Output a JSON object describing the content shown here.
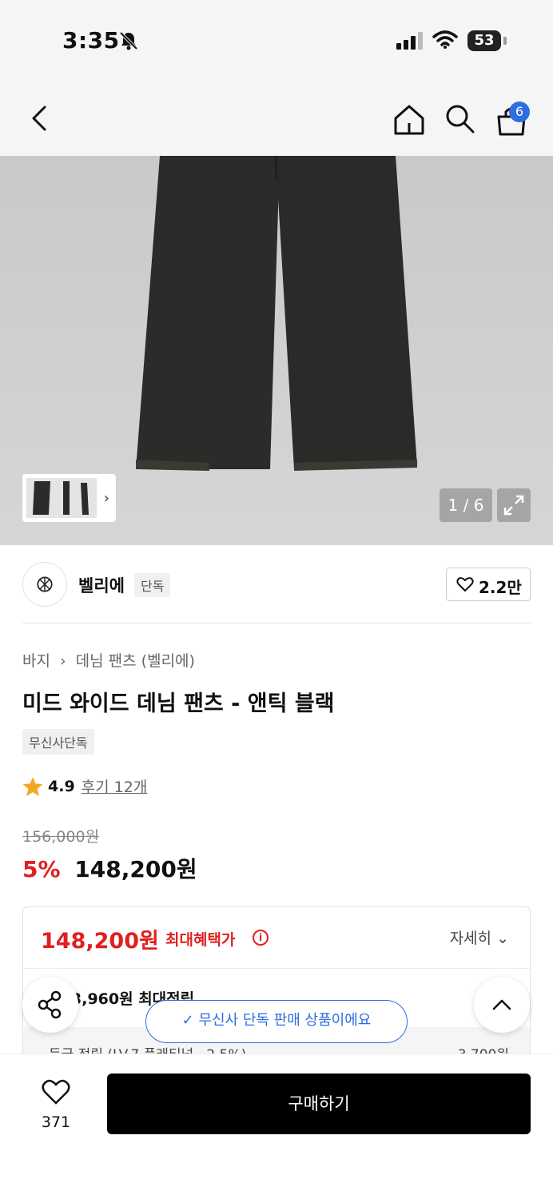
{
  "status": {
    "time": "3:35",
    "battery": "53"
  },
  "header": {
    "cart_count": "6"
  },
  "gallery": {
    "counter": "1 / 6"
  },
  "brand": {
    "name": "벨리에",
    "tag": "단독",
    "likes": "2.2만"
  },
  "breadcrumb": {
    "category": "바지",
    "sub": "데님 팬츠 (벨리에)"
  },
  "product": {
    "title": "미드 와이드 데님 팬츠 - 앤틱 블랙",
    "exclusive_tag": "무신사단독",
    "rating": "4.9",
    "reviews": "후기 12개",
    "original_price": "156,000원",
    "discount": "5%",
    "price": "148,200원"
  },
  "benefit": {
    "price": "148,200원",
    "label": "최대혜택가",
    "detail": "자세히",
    "point_line": "3,960원 최대적립",
    "grade_label": "등급 적립 (LV.7 플래티넘 · 2.5%)",
    "grade_value": "3,700원"
  },
  "toast": {
    "text": "무신사 단독 판매 상품이에요"
  },
  "bottom": {
    "wish_count": "371",
    "buy_label": "구매하기"
  },
  "colors": {
    "accent_red": "#e02020",
    "accent_blue": "#2f6de0",
    "cta_black": "#000000"
  }
}
